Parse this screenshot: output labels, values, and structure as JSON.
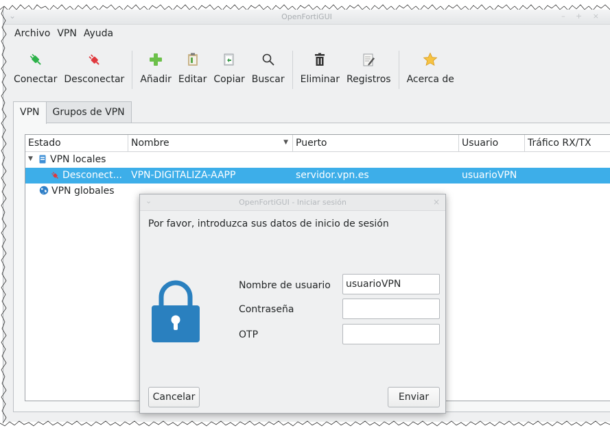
{
  "window": {
    "title": "OpenFortiGUI"
  },
  "menu": [
    "Archivo",
    "VPN",
    "Ayuda"
  ],
  "toolbar": {
    "connect": "Conectar",
    "disconnect": "Desconectar",
    "add": "Añadir",
    "edit": "Editar",
    "copy": "Copiar",
    "search": "Buscar",
    "delete": "Eliminar",
    "logs": "Registros",
    "about": "Acerca de"
  },
  "tabs": [
    "VPN",
    "Grupos de VPN"
  ],
  "table": {
    "columns": [
      "Estado",
      "Nombre",
      "Puerto",
      "Usuario",
      "Tráfico RX/TX"
    ],
    "groups": {
      "local": "VPN locales",
      "global": "VPN globales"
    },
    "rows": [
      {
        "status": "Desconect...",
        "name": "VPN-DIGITALIZA-AAPP",
        "port": "servidor.vpn.es",
        "user": "usuarioVPN",
        "traffic": ""
      }
    ]
  },
  "dialog": {
    "title": "OpenFortiGUI - Iniciar sesión",
    "message": "Por favor, introduzca sus datos de inicio de sesión",
    "username_label": "Nombre de usuario",
    "username_value": "usuarioVPN",
    "password_label": "Contraseña",
    "password_value": "",
    "otp_label": "OTP",
    "otp_value": "",
    "cancel": "Cancelar",
    "submit": "Enviar"
  },
  "colors": {
    "selection": "#3daee9",
    "lock": "#2a80bf",
    "connect_icon": "#2db24a",
    "disconnect_icon": "#e0393e"
  }
}
